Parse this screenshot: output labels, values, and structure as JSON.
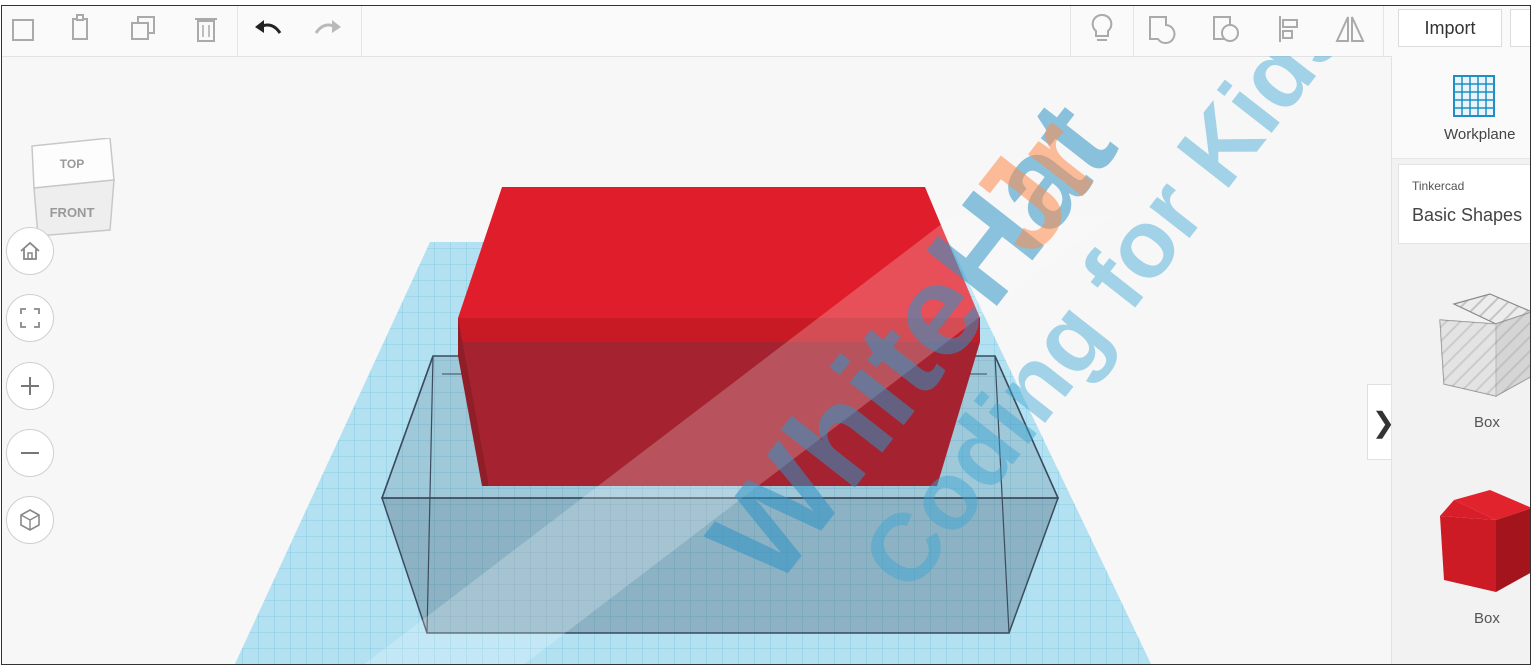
{
  "toolbar": {
    "left_icons": [
      "new-shape-icon",
      "copy-icon",
      "duplicate-icon",
      "delete-icon"
    ],
    "undo_icon": "undo-arrow-icon",
    "redo_icon": "redo-arrow-icon",
    "right_icons": [
      "light-bulb-icon",
      "group-icon",
      "ungroup-icon",
      "align-icon",
      "mirror-icon"
    ],
    "import_label": "Import"
  },
  "viewcube": {
    "top_label": "TOP",
    "front_label": "FRONT"
  },
  "nav_controls": [
    "home-icon",
    "fit-view-icon",
    "zoom-in-icon",
    "zoom-out-icon",
    "perspective-icon"
  ],
  "panel": {
    "workplane_label": "Workplane",
    "library_source": "Tinkercad",
    "library_name": "Basic Shapes",
    "shapes": [
      {
        "label": "Box",
        "style": "hole"
      },
      {
        "label": "Box",
        "style": "solid"
      }
    ],
    "collapse_glyph": "❯"
  },
  "watermark": {
    "brand_part1": "WhiteHat",
    "brand_part2": "Jr",
    "tagline": "Coding for Kids"
  },
  "colors": {
    "red_box": "#e01e2b",
    "workplane": "#a9dcee",
    "hole_box": "#8aa4b8"
  }
}
